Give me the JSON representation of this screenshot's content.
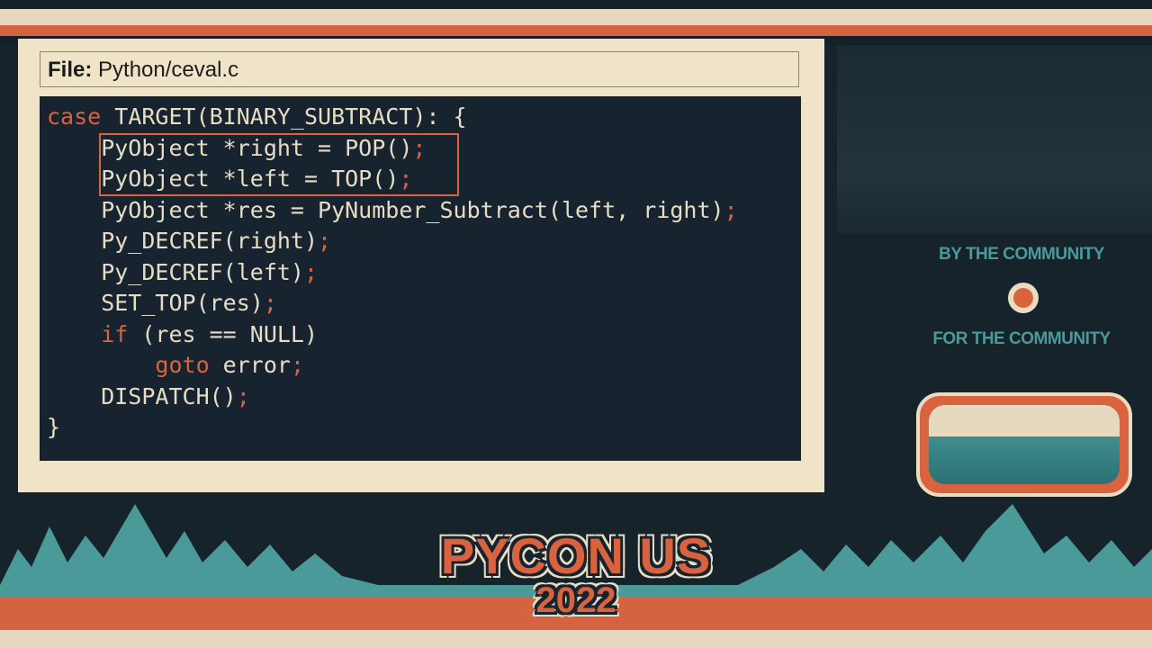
{
  "slide": {
    "file_label": "File:",
    "file_path": "Python/ceval.c",
    "code": {
      "l1_kw": "case",
      "l1_rest": " TARGET(BINARY_SUBTRACT): {",
      "l2": "    PyObject *right = POP()",
      "l3": "    PyObject *left = TOP()",
      "l4": "    PyObject *res = PyNumber_Subtract(left, right)",
      "l5": "    Py_DECREF(right)",
      "l6": "    Py_DECREF(left)",
      "l7": "    SET_TOP(res)",
      "l8_kw": "    if",
      "l8_rest": " (res == NULL)",
      "l9_kw": "        goto",
      "l9_rest": " error",
      "l10": "    DISPATCH()",
      "l11": "}",
      "semicolon": ";"
    }
  },
  "sidebar": {
    "tagline_top": "BY THE COMMUNITY",
    "tagline_bottom": "FOR THE COMMUNITY"
  },
  "event": {
    "name": "PYCON US",
    "year": "2022"
  },
  "colors": {
    "accent": "#d9633f",
    "teal": "#4a9a9a",
    "cream": "#efe4c8",
    "code_bg": "#172430"
  }
}
